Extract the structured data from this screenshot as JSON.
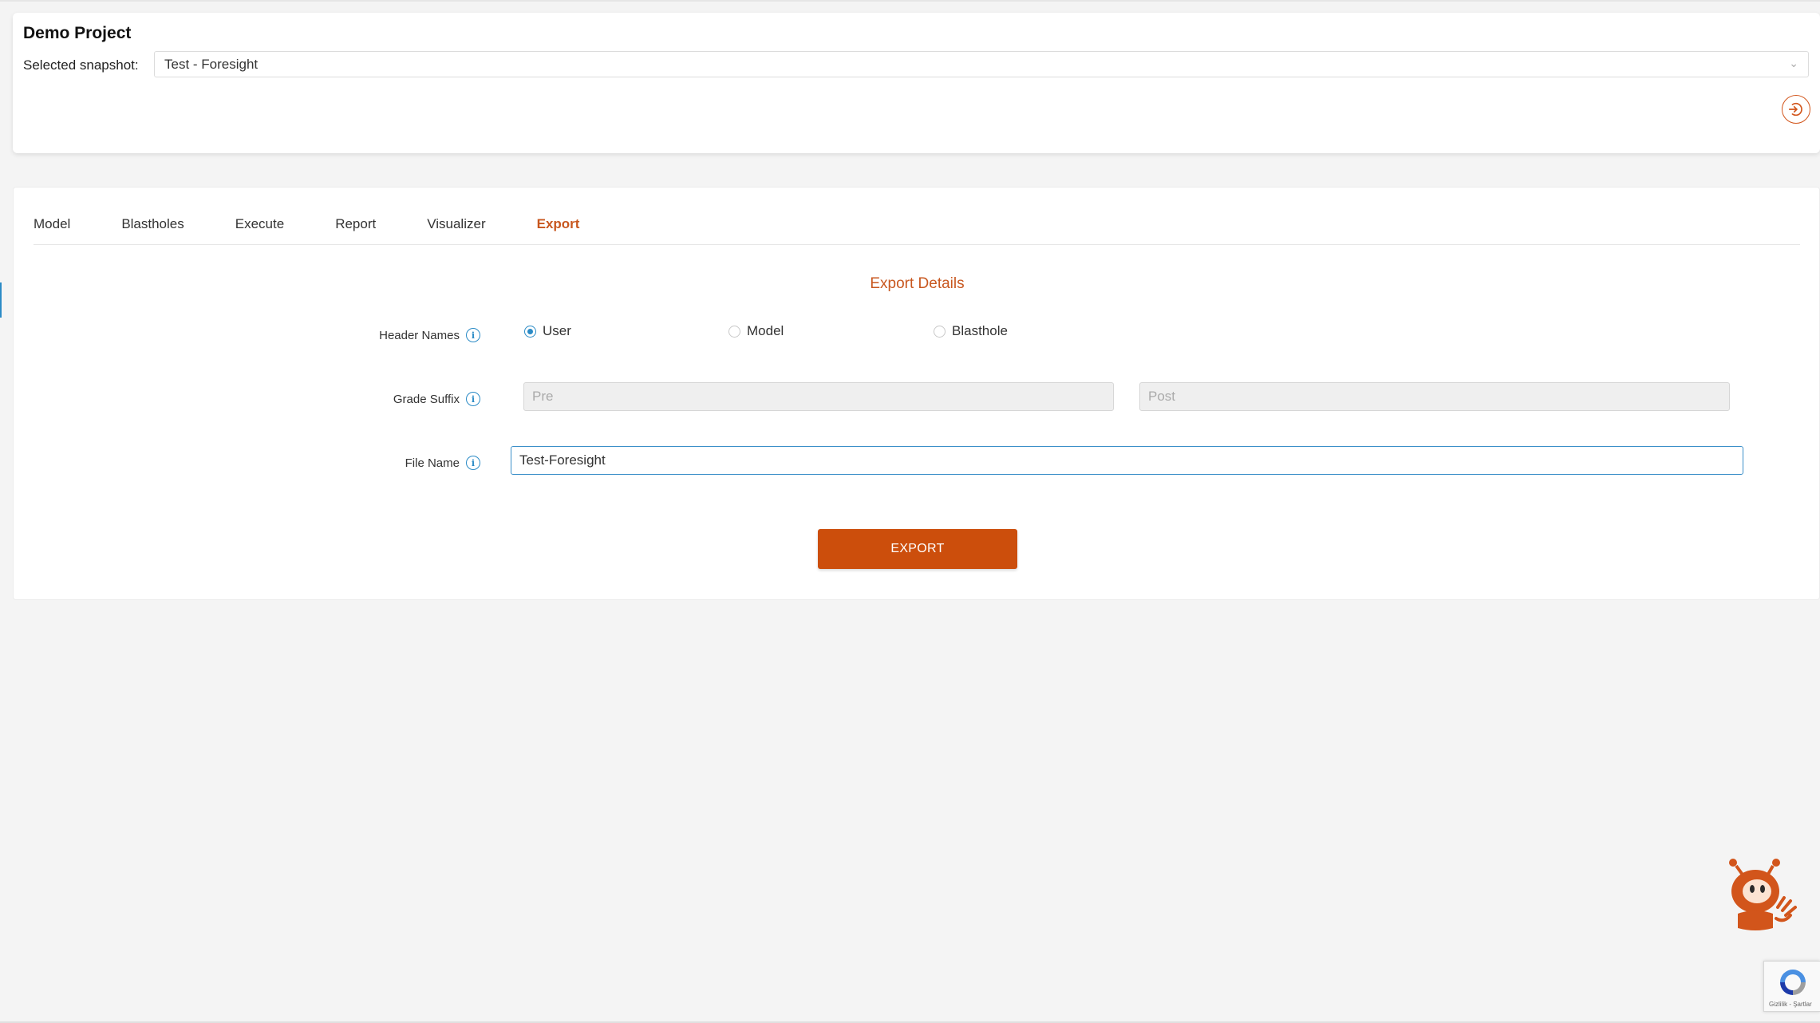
{
  "project": {
    "title": "Demo Project",
    "snapshot_label": "Selected snapshot:",
    "snapshot_value": "Test - Foresight"
  },
  "tabs": [
    {
      "label": "Model",
      "active": false
    },
    {
      "label": "Blastholes",
      "active": false
    },
    {
      "label": "Execute",
      "active": false
    },
    {
      "label": "Report",
      "active": false
    },
    {
      "label": "Visualizer",
      "active": false
    },
    {
      "label": "Export",
      "active": true
    }
  ],
  "export": {
    "section_title": "Export Details",
    "header_names": {
      "label": "Header Names",
      "options": [
        "User",
        "Model",
        "Blasthole"
      ],
      "selected": "User"
    },
    "grade_suffix": {
      "label": "Grade Suffix",
      "pre_placeholder": "Pre",
      "post_placeholder": "Post"
    },
    "file_name": {
      "label": "File Name",
      "value": "Test-Foresight"
    },
    "button_label": "EXPORT"
  },
  "recaptcha": {
    "footer_text": "Gizlilik - Şartlar"
  },
  "colors": {
    "accent": "#cc4e0c",
    "focus": "#2b8bc6"
  },
  "icons": [
    "chevron-down-icon",
    "logout-icon",
    "info-icon",
    "mascot-icon",
    "recaptcha-icon"
  ]
}
